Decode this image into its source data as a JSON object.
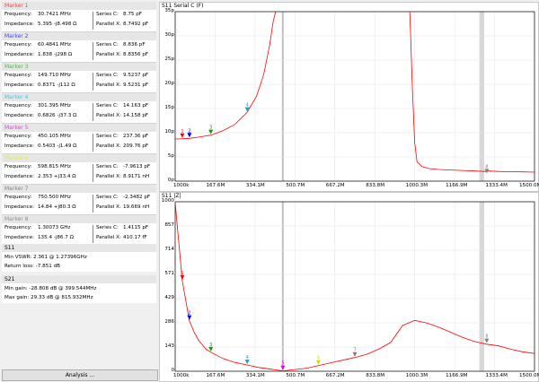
{
  "markers": [
    {
      "title": "Marker 1",
      "color": "#ff4040",
      "freq_label": "Frequency:",
      "freq": "30.7421 MHz",
      "imp_label": "Impedance:",
      "imp": "5.395 -j8.498 Ω",
      "sc_label": "Series C:",
      "sc": "8.75 pF",
      "px_label": "Parallel X:",
      "px": "8.7492 pF"
    },
    {
      "title": "Marker 2",
      "color": "#4040ff",
      "freq_label": "Frequency:",
      "freq": "60.4841 MHz",
      "imp_label": "Impedance:",
      "imp": "1.838 -j298 Ω",
      "sc_label": "Series C:",
      "sc": "8.836 pF",
      "px_label": "Parallel X:",
      "px": "8.8356 pF"
    },
    {
      "title": "Marker 3",
      "color": "#40c040",
      "freq_label": "Frequency:",
      "freq": "149.710 MHz",
      "imp_label": "Impedance:",
      "imp": "0.8371 -j112 Ω",
      "sc_label": "Series C:",
      "sc": "9.5237 pF",
      "px_label": "Parallel X:",
      "px": "9.5231 pF"
    },
    {
      "title": "Marker 4",
      "color": "#40c8e0",
      "freq_label": "Frequency:",
      "freq": "301.395 MHz",
      "imp_label": "Impedance:",
      "imp": "0.6826 -j37.3 Ω",
      "sc_label": "Series C:",
      "sc": "14.163 pF",
      "px_label": "Parallel X:",
      "px": "14.158 pF"
    },
    {
      "title": "Marker 5",
      "color": "#e040e0",
      "freq_label": "Frequency:",
      "freq": "450.105 MHz",
      "imp_label": "Impedance:",
      "imp": "0.5403 -j1.49 Ω",
      "sc_label": "Series C:",
      "sc": "237.36 pF",
      "px_label": "Parallel X:",
      "px": "209.76 pF"
    },
    {
      "title": "Marker 6",
      "color": "#e8e840",
      "freq_label": "Frequency:",
      "freq": "598.815 MHz",
      "imp_label": "Impedance:",
      "imp": "2.353 +j33.4 Ω",
      "sc_label": "Series C:",
      "sc": "-7.9613 pF",
      "px_label": "Parallel X:",
      "px": "8.9171 nH"
    },
    {
      "title": "Marker 7",
      "color": "#808080",
      "freq_label": "Frequency:",
      "freq": "750.500 MHz",
      "imp_label": "Impedance:",
      "imp": "14.84 +j80.3 Ω",
      "sc_label": "Series C:",
      "sc": "-2.3482 pF",
      "px_label": "Parallel X:",
      "px": "19.669 nH"
    },
    {
      "title": "Marker 8",
      "color": "#909090",
      "freq_label": "Frequency:",
      "freq": "1.30073 GHz",
      "imp_label": "Impedance:",
      "imp": "135.4 -j86.7 Ω",
      "sc_label": "Series C:",
      "sc": "1.4115 pF",
      "px_label": "Parallel X:",
      "px": "410.17 fF"
    }
  ],
  "s11": {
    "title": "S11",
    "line1": "Min VSWR:  2.361 @ 1.27396GHz",
    "line2": "Return loss:  -7.851 dB"
  },
  "s21": {
    "title": "S21",
    "line1": "Min gain:  -28.808 dB @ 399.544MHz",
    "line2": "Max gain:  29.33 dB @ 815.932MHz"
  },
  "analysis_button": "Analysis ...",
  "chart_data": [
    {
      "type": "line",
      "title": "S11 Serial C (F)",
      "y_ticks": [
        "35p",
        "30p",
        "25p",
        "20p",
        "15p",
        "10p",
        "5p",
        "0p"
      ],
      "ylim": [
        0,
        35
      ],
      "x_ticks": [
        "1000k",
        "167.6M",
        "334.1M",
        "500.7M",
        "667.2M",
        "833.8M",
        "1000.3M",
        "1166.9M",
        "1333.4M",
        "1500.0M"
      ],
      "xlim": [
        1,
        1500
      ],
      "series": [
        {
          "color": "#ff0000",
          "x": [
            1,
            30,
            60,
            100,
            150,
            200,
            250,
            301,
            340,
            370,
            395,
            410,
            420,
            440,
            470,
            520,
            600,
            700,
            800,
            900,
            950,
            980,
            990,
            1000,
            1010,
            1030,
            1060,
            1100,
            1150,
            1200,
            1250,
            1290,
            1300,
            1310,
            1350,
            1400,
            1450,
            1500
          ],
          "y": [
            8.7,
            8.75,
            8.84,
            9.1,
            9.5,
            10.4,
            11.7,
            14.2,
            17.5,
            22,
            28,
            33,
            36,
            null,
            null,
            null,
            null,
            null,
            null,
            null,
            null,
            35,
            20,
            8,
            4,
            3,
            2.6,
            2.4,
            2.3,
            2.2,
            2.1,
            2.0,
            2.0,
            2.1,
            2.0,
            1.95,
            1.9,
            1.85
          ]
        }
      ],
      "markers": [
        {
          "label": "1",
          "x": 30.7,
          "y": 8.75,
          "color": "#ff0000"
        },
        {
          "label": "2",
          "x": 60.5,
          "y": 8.84,
          "color": "#0000ff"
        },
        {
          "label": "3",
          "x": 149.7,
          "y": 9.52,
          "color": "#00a000"
        },
        {
          "label": "4",
          "x": 301.4,
          "y": 14.16,
          "color": "#00b0d0"
        },
        {
          "label": "8",
          "x": 1300.7,
          "y": 1.41,
          "color": "#808080"
        }
      ],
      "highlights": [
        {
          "x_from": 1270,
          "x_to": 1290
        }
      ]
    },
    {
      "type": "line",
      "title": "S11 |Z|",
      "y_ticks": [
        "1000",
        "857",
        "714",
        "571",
        "429",
        "286",
        "143",
        "0"
      ],
      "ylim": [
        0,
        1000
      ],
      "x_ticks": [
        "1000k",
        "167.6M",
        "334.1M",
        "500.7M",
        "667.2M",
        "833.8M",
        "1000.3M",
        "1166.9M",
        "1333.4M",
        "1500.0M"
      ],
      "xlim": [
        1,
        1500
      ],
      "series": [
        {
          "color": "#ff0000",
          "x": [
            1,
            10,
            20,
            30,
            45,
            60,
            80,
            100,
            130,
            150,
            200,
            250,
            301,
            350,
            400,
            450,
            500,
            550,
            600,
            650,
            700,
            750,
            800,
            850,
            900,
            950,
            1000,
            1050,
            1100,
            1150,
            1200,
            1250,
            1300,
            1350,
            1400,
            1450,
            1500
          ],
          "y": [
            1000,
            850,
            700,
            540,
            420,
            300,
            230,
            180,
            130,
            112,
            75,
            52,
            37,
            22,
            12,
            2,
            10,
            18,
            34,
            50,
            65,
            81,
            100,
            130,
            170,
            270,
            300,
            285,
            260,
            230,
            200,
            175,
            160,
            150,
            130,
            115,
            105
          ]
        }
      ],
      "markers": [
        {
          "label": "1",
          "x": 30.7,
          "y": 535,
          "color": "#ff0000"
        },
        {
          "label": "2",
          "x": 60.5,
          "y": 298,
          "color": "#0000ff"
        },
        {
          "label": "3",
          "x": 149.7,
          "y": 112,
          "color": "#00a000"
        },
        {
          "label": "4",
          "x": 301.4,
          "y": 37,
          "color": "#00b0d0"
        },
        {
          "label": "5",
          "x": 450.1,
          "y": 2,
          "color": "#e000e0"
        },
        {
          "label": "6",
          "x": 598.8,
          "y": 34,
          "color": "#d8d800"
        },
        {
          "label": "7",
          "x": 750.5,
          "y": 81,
          "color": "#808080"
        },
        {
          "label": "8",
          "x": 1300.7,
          "y": 161,
          "color": "#808080"
        }
      ],
      "highlights": [
        {
          "x_from": 1270,
          "x_to": 1290
        }
      ]
    }
  ]
}
